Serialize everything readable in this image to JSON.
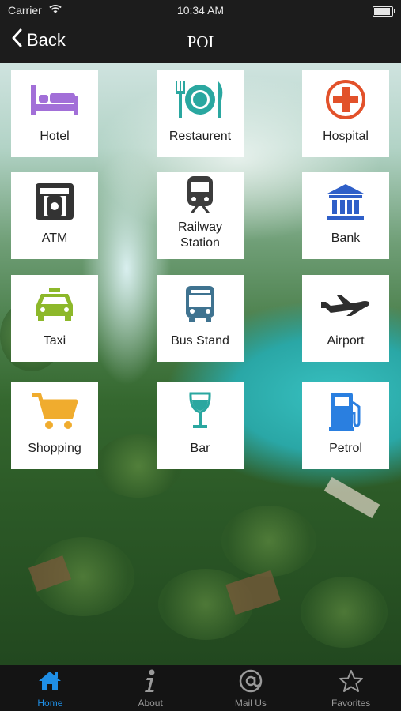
{
  "status_bar": {
    "carrier": "Carrier",
    "time": "10:34 AM"
  },
  "nav": {
    "back_label": "Back",
    "title": "POI"
  },
  "tiles": [
    {
      "label": "Hotel",
      "icon": "bed-icon",
      "color": "#a26fd8"
    },
    {
      "label": "Restaurent",
      "icon": "plate-cutlery-icon",
      "color": "#2aa7a0"
    },
    {
      "label": "Hospital",
      "icon": "medical-cross-icon",
      "color": "#e2512a"
    },
    {
      "label": "ATM",
      "icon": "atm-icon",
      "color": "#333333"
    },
    {
      "label": "Railway Station",
      "icon": "train-icon",
      "color": "#3c3c3c"
    },
    {
      "label": "Bank",
      "icon": "bank-icon",
      "color": "#2f5fc8"
    },
    {
      "label": "Taxi",
      "icon": "taxi-icon",
      "color": "#8db82a"
    },
    {
      "label": "Bus Stand",
      "icon": "bus-icon",
      "color": "#3f7390"
    },
    {
      "label": "Airport",
      "icon": "airplane-icon",
      "color": "#2e2e2e"
    },
    {
      "label": "Shopping",
      "icon": "shopping-cart-icon",
      "color": "#f0ac2e"
    },
    {
      "label": "Bar",
      "icon": "wine-glass-icon",
      "color": "#2aa7a0"
    },
    {
      "label": "Petrol",
      "icon": "fuel-pump-icon",
      "color": "#2a7fe0"
    }
  ],
  "tabs": [
    {
      "label": "Home",
      "icon": "home-icon",
      "active": true
    },
    {
      "label": "About",
      "icon": "info-icon",
      "active": false
    },
    {
      "label": "Mail Us",
      "icon": "at-mail-icon",
      "active": false
    },
    {
      "label": "Favorites",
      "icon": "star-icon",
      "active": false
    }
  ],
  "colors": {
    "accent": "#1f8fe6",
    "nav_bg": "#1c1c1c",
    "tabbar_bg": "#141414"
  }
}
